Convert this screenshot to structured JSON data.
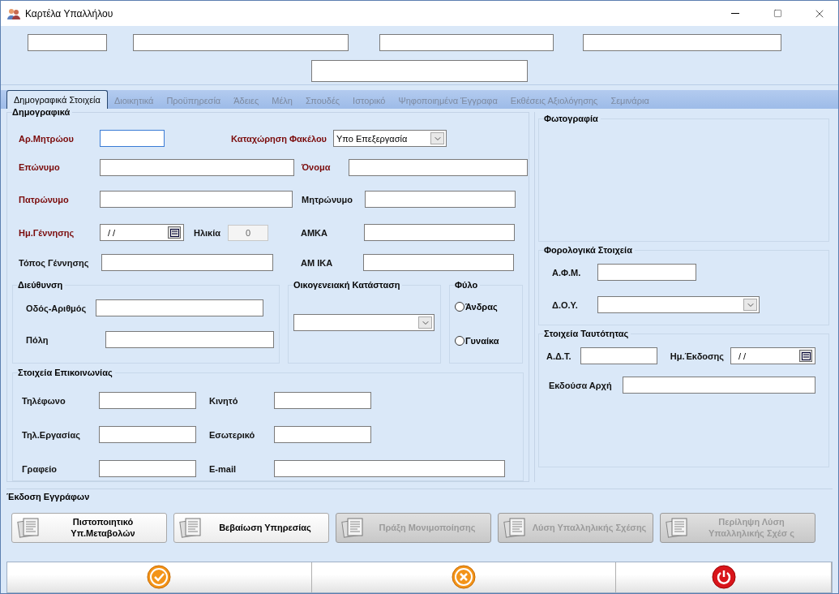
{
  "window": {
    "title": "Καρτέλα Υπαλλήλου"
  },
  "tabs": [
    {
      "label": "Δημογραφικά Στοιχεία",
      "selected": true
    },
    {
      "label": "Διοικητικά",
      "selected": false
    },
    {
      "label": "Προϋπηρεσία",
      "selected": false
    },
    {
      "label": "Άδειες",
      "selected": false
    },
    {
      "label": "Μέλη",
      "selected": false
    },
    {
      "label": "Σπουδές",
      "selected": false
    },
    {
      "label": "Ιστορικό",
      "selected": false
    },
    {
      "label": "Ψηφοποιημένα Έγγραφα",
      "selected": false
    },
    {
      "label": "Εκθέσεις Αξιολόγησης",
      "selected": false
    },
    {
      "label": "Σεμινάρια",
      "selected": false
    }
  ],
  "demographics": {
    "title": "Δημογραφικά",
    "registry_no": {
      "label": "Αρ.Μητρώου",
      "required": true
    },
    "file_status": {
      "label": "Καταχώρηση Φακέλου",
      "required": true,
      "value": "Υπο Επεξεργασία"
    },
    "surname": {
      "label": "Επώνυμο",
      "required": true
    },
    "first_name": {
      "label": "Όνομα",
      "required": true
    },
    "father_name": {
      "label": "Πατρώνυμο",
      "required": true
    },
    "mother_name": {
      "label": "Μητρώνυμο",
      "required": false
    },
    "birth_date": {
      "label": "Ημ.Γέννησης",
      "required": true,
      "value": "/ /"
    },
    "age": {
      "label": "Ηλικία",
      "value": "0"
    },
    "amka": {
      "label": "ΑΜΚΑ",
      "required": false
    },
    "birth_place": {
      "label": "Τόπος Γέννησης",
      "required": false
    },
    "am_ika": {
      "label": "ΑΜ ΙΚΑ",
      "required": false
    }
  },
  "address": {
    "title": "Διεύθυνση",
    "street": "Οδός-Αριθμός",
    "city": "Πόλη"
  },
  "family_status": {
    "title": "Οικογενειακή Κατάσταση"
  },
  "gender": {
    "title": "Φύλο",
    "options": [
      {
        "label": "Άνδρας",
        "selected": false
      },
      {
        "label": "Γυναίκα",
        "selected": false
      }
    ]
  },
  "contact": {
    "title": "Στοιχεία Επικοινωνίας",
    "fields": [
      {
        "label": "Τηλέφωνο",
        "wide": false
      },
      {
        "label": "Κινητό",
        "wide": false
      },
      {
        "label": "Τηλ.Εργασίας",
        "wide": false
      },
      {
        "label": "Εσωτερικό",
        "wide": false
      },
      {
        "label": "Γραφείο",
        "wide": false
      },
      {
        "label": "E-mail",
        "wide": true
      }
    ]
  },
  "photo": {
    "title": "Φωτογραφία"
  },
  "tax": {
    "title": "Φορολογικά Στοιχεία",
    "afm": "Α.Φ.Μ.",
    "doy": "Δ.Ο.Υ."
  },
  "identity": {
    "title": "Στοιχεία Ταυτότητας",
    "id_no": "Α.Δ.Τ.",
    "issue_date": {
      "label": "Ημ.Έκδοσης",
      "value": "/ /"
    },
    "authority": "Εκδούσα Αρχή"
  },
  "documents": {
    "title": "Έκδοση Εγγράφων",
    "buttons": [
      {
        "label": "Πιστοποιητικό\nΥπ.Μεταβολών",
        "disabled": false
      },
      {
        "label": "Βεβαίωση Υπηρεσίας",
        "disabled": false
      },
      {
        "label": "Πράξη Μονιμοποίησης",
        "disabled": true
      },
      {
        "label": "Λύση Υπαλληλικής Σχέσης",
        "disabled": true
      },
      {
        "label": "Περίληψη Λύση\nΥπαλληλικής Σχέσ ς",
        "disabled": true
      }
    ]
  },
  "actions": [
    {
      "kind": "ok"
    },
    {
      "kind": "cancel"
    },
    {
      "kind": "exit"
    }
  ]
}
